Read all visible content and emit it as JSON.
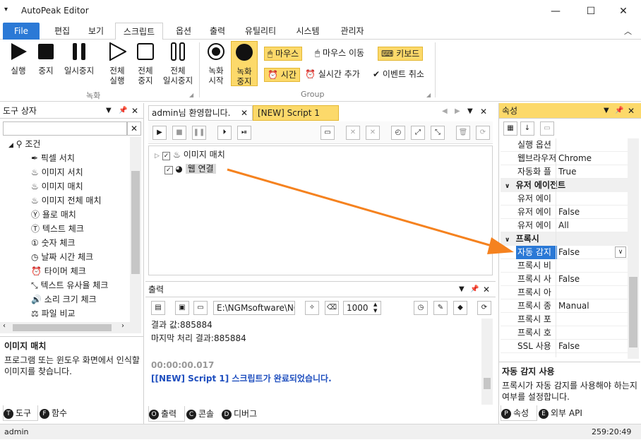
{
  "app": {
    "title": "AutoPeak Editor"
  },
  "menu_tabs": [
    "File",
    "편집",
    "보기",
    "스크립트",
    "옵션",
    "출력",
    "유틸리티",
    "시스템",
    "관리자"
  ],
  "ribbon": {
    "record_group": {
      "label": "녹화",
      "buttons": [
        {
          "label1": "실행",
          "label2": ""
        },
        {
          "label1": "중지",
          "label2": ""
        },
        {
          "label1": "일시중지",
          "label2": ""
        },
        {
          "label1": "전체",
          "label2": "실행"
        },
        {
          "label1": "전체",
          "label2": "중지"
        },
        {
          "label1": "전체",
          "label2": "일시중지"
        }
      ]
    },
    "group_group": {
      "label": "Group",
      "record_start": {
        "label1": "녹화",
        "label2": "시작"
      },
      "record_stop": {
        "label1": "녹화",
        "label2": "중지"
      },
      "mouse": "마우스",
      "mouse_move": "마우스 이동",
      "keyboard": "키보드",
      "time": "시간",
      "realtime_add": "실시간 추가",
      "event_cancel": "이벤트 취소"
    }
  },
  "toolbox": {
    "title": "도구 상자",
    "root": "조건",
    "items": [
      "픽셀 서치",
      "이미지 서치",
      "이미지 매치",
      "이미지 전체 매치",
      "욜로 매치",
      "텍스트 체크",
      "숫자 체크",
      "날짜 시간 체크",
      "타이머 체크",
      "텍스트 유사율 체크",
      "소리 크기 체크",
      "파일 비교"
    ],
    "desc_title": "이미지 매치",
    "desc_text": "프로그램 또는 윈도우 화면에서 인식할 이미지를 찾습니다.",
    "tabs": [
      "도구",
      "함수"
    ]
  },
  "editor": {
    "tabs": [
      "admin님 환영합니다.",
      "[NEW] Script 1"
    ],
    "nodes": [
      "이미지 매치",
      "웹 연결"
    ]
  },
  "output": {
    "title": "출력",
    "path": "E:\\NGMsoftware\\NG",
    "interval": "1000",
    "lines": [
      "결과 값:885884",
      "마지막 처리 결과:885884"
    ],
    "elapsed": "00:00:00.017",
    "done": "[[NEW] Script 1] 스크립트가 완료되었습니다.",
    "tabs": [
      "출력",
      "콘솔",
      "디버그"
    ]
  },
  "properties": {
    "title": "속성",
    "rows": [
      {
        "kind": "row",
        "name": "실행 옵션",
        "value": ""
      },
      {
        "kind": "row",
        "name": "웹브라우저",
        "value": "Chrome"
      },
      {
        "kind": "row",
        "name": "자동화 플",
        "value": "True"
      },
      {
        "kind": "cat",
        "name": "유저 에이전트",
        "value": ""
      },
      {
        "kind": "row",
        "name": "유저 에이",
        "value": ""
      },
      {
        "kind": "row",
        "name": "유저 에이",
        "value": "False"
      },
      {
        "kind": "row",
        "name": "유저 에이",
        "value": "All"
      },
      {
        "kind": "cat",
        "name": "프록시",
        "value": ""
      },
      {
        "kind": "sel",
        "name": "자동 감지",
        "value": "False"
      },
      {
        "kind": "row",
        "name": "프록시 비",
        "value": ""
      },
      {
        "kind": "row",
        "name": "프록시 사",
        "value": "False"
      },
      {
        "kind": "row",
        "name": "프록시 아",
        "value": ""
      },
      {
        "kind": "row",
        "name": "프록시 종",
        "value": "Manual"
      },
      {
        "kind": "row",
        "name": "프록시 포",
        "value": ""
      },
      {
        "kind": "row",
        "name": "프록시 호",
        "value": ""
      },
      {
        "kind": "row",
        "name": "SSL 사용",
        "value": "False"
      }
    ],
    "desc_title": "자동 감지 사용",
    "desc_text": "프록시가 자동 감지를 사용해야 하는지 여부를 설정합니다.",
    "tabs": [
      "속성",
      "외부 API"
    ]
  },
  "status": {
    "user": "admin",
    "time": "259:20:49"
  },
  "colors": {
    "accent": "#2b79d6",
    "highlight": "#fcd96a",
    "arrow": "#f5821f",
    "link": "#1f4fbf"
  }
}
